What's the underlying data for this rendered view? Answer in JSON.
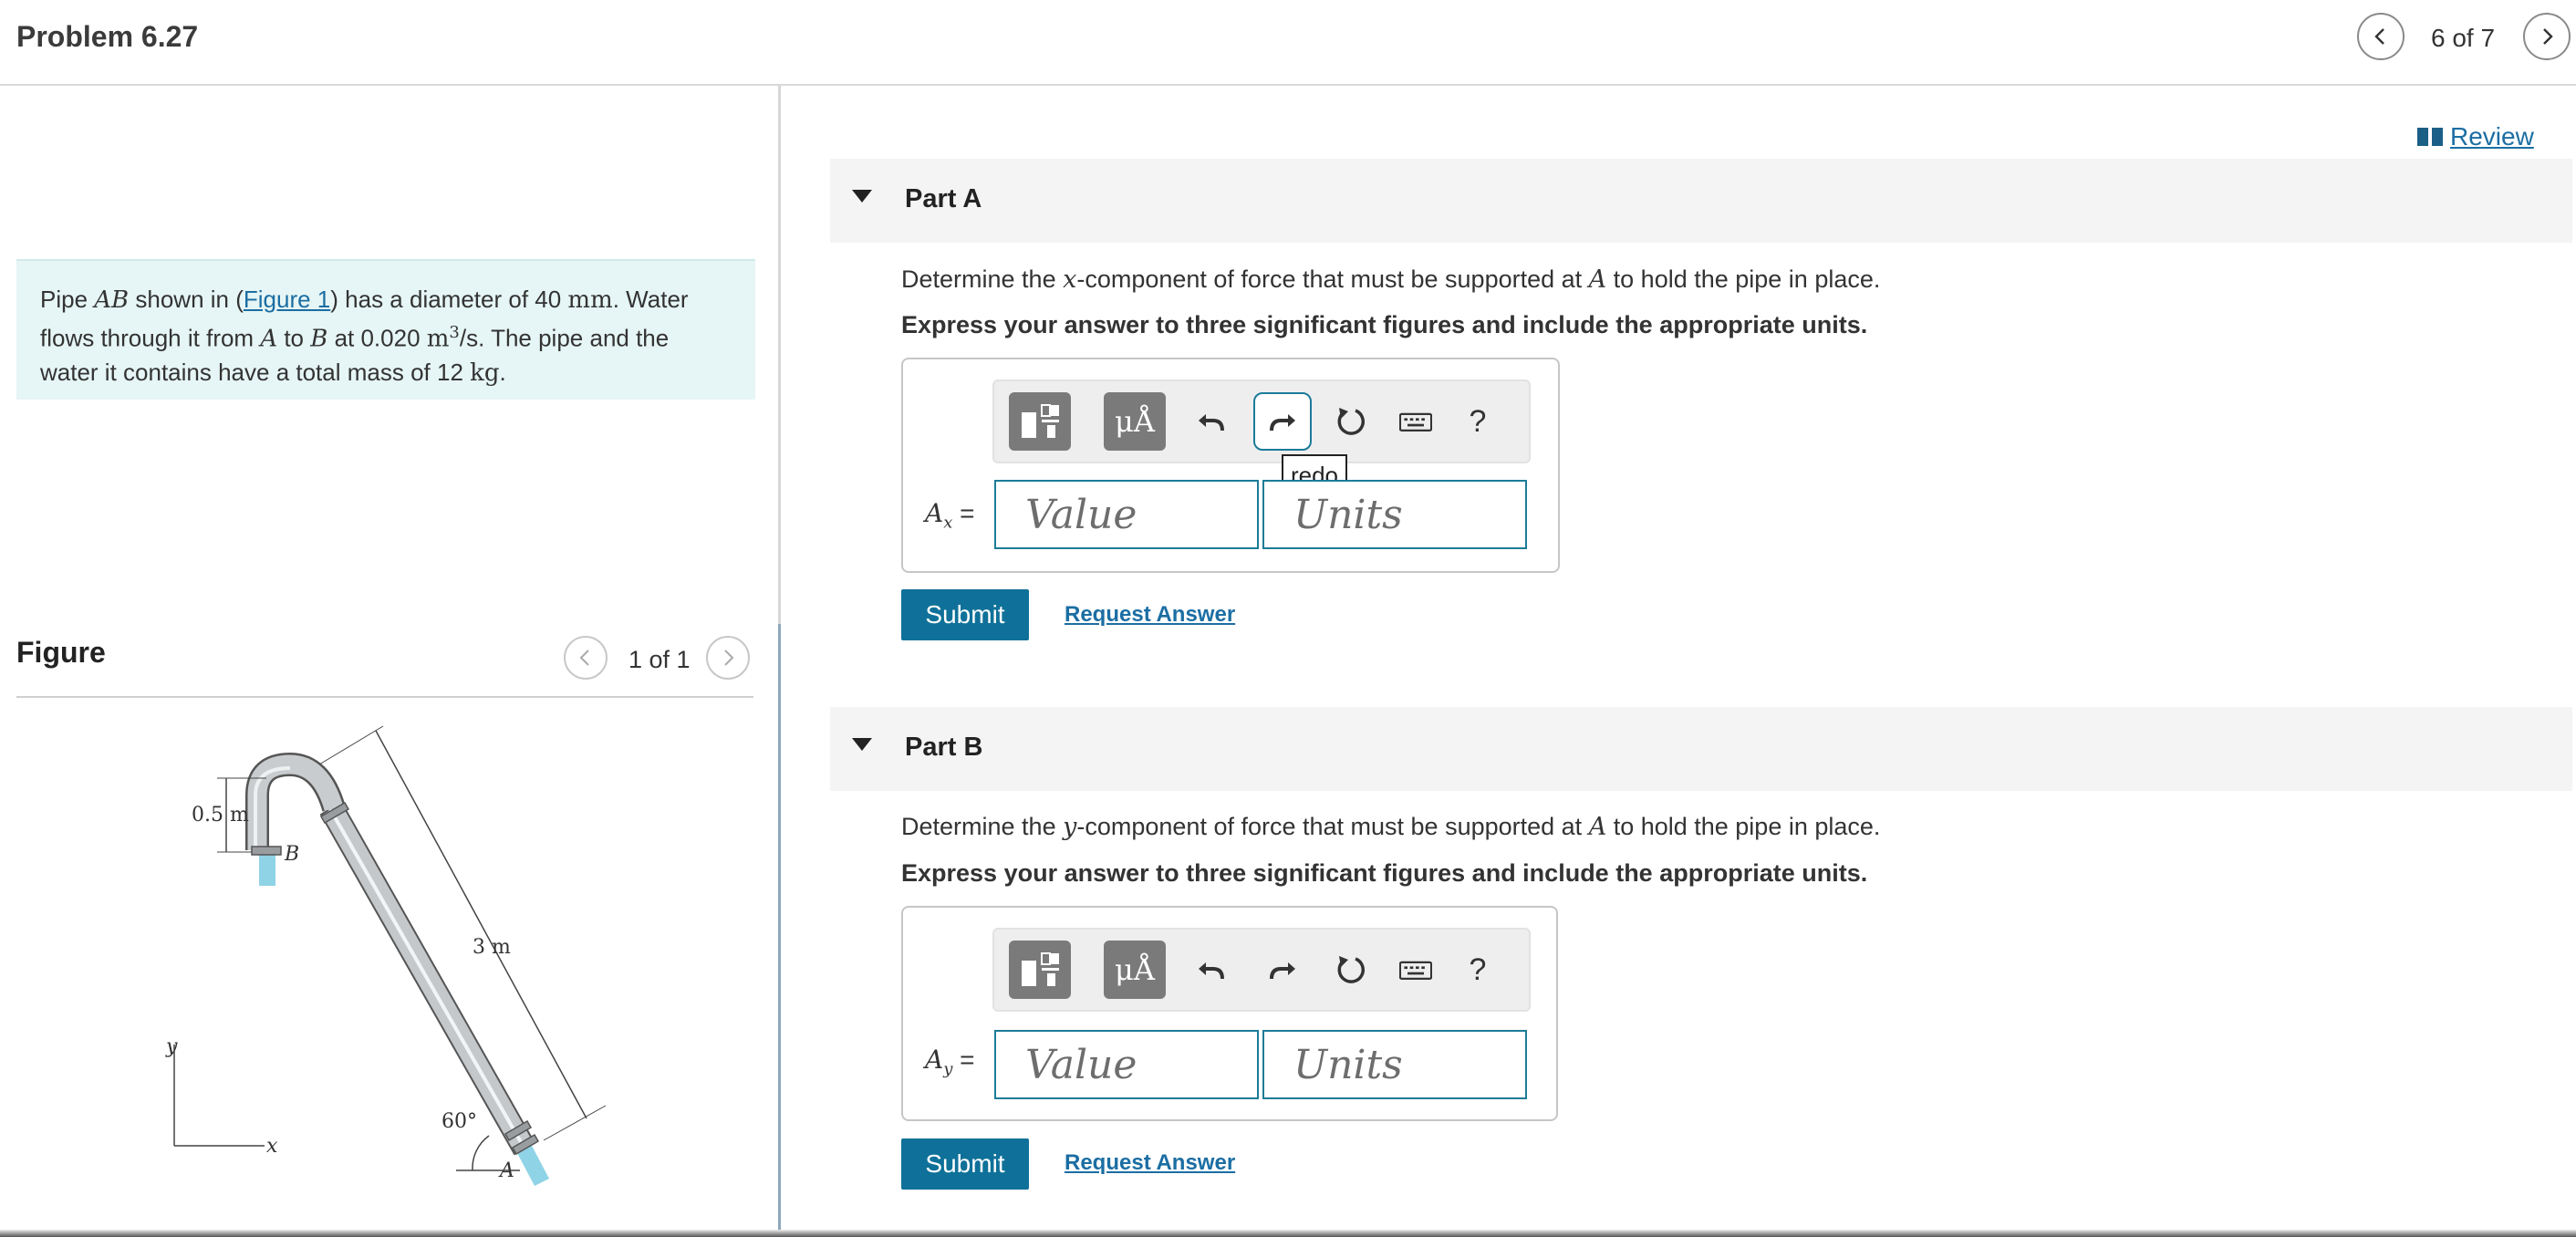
{
  "header": {
    "title": "Problem 6.27",
    "pager": "6 of 7"
  },
  "intro": {
    "t1": "Pipe ",
    "m1": "AB",
    "t2": " shown in (",
    "link": "Figure 1",
    "t3": ") has a diameter of 40 ",
    "u1": "mm",
    "t4": ". Water flows through it from ",
    "m2": "A",
    "t5": " to ",
    "m3": "B",
    "t6": " at 0.020 ",
    "u2": "m",
    "sup": "3",
    "t7": "/s. The pipe and the water it contains have a total mass of 12 ",
    "u3": "kg",
    "t8": "."
  },
  "figure": {
    "title": "Figure",
    "pager": "1 of 1",
    "labels": {
      "height": "0.5 m",
      "b": "B",
      "length": "3 m",
      "angle": "60°",
      "a": "A",
      "x": "x",
      "y": "y"
    }
  },
  "review": {
    "label": "Review"
  },
  "toolbar": {
    "units_symbol": "μÅ",
    "help": "?",
    "tooltip": "redo"
  },
  "partA": {
    "title": "Part A",
    "q1": "Determine the ",
    "qvar": "x",
    "q2": "-component of force that must be supported at ",
    "qpoint": "A",
    "q3": " to hold the pipe in place.",
    "instruction": "Express your answer to three significant figures and include the appropriate units.",
    "label_var": "A",
    "label_sub": "x",
    "label_eq": " =",
    "value_placeholder": "Value",
    "units_placeholder": "Units",
    "submit": "Submit",
    "request": "Request Answer"
  },
  "partB": {
    "title": "Part B",
    "q1": "Determine the ",
    "qvar": "y",
    "q2": "-component of force that must be supported at ",
    "qpoint": "A",
    "q3": " to hold the pipe in place.",
    "instruction": "Express your answer to three significant figures and include the appropriate units.",
    "label_var": "A",
    "label_sub": "y",
    "label_eq": " =",
    "value_placeholder": "Value",
    "units_placeholder": "Units",
    "submit": "Submit",
    "request": "Request Answer"
  }
}
